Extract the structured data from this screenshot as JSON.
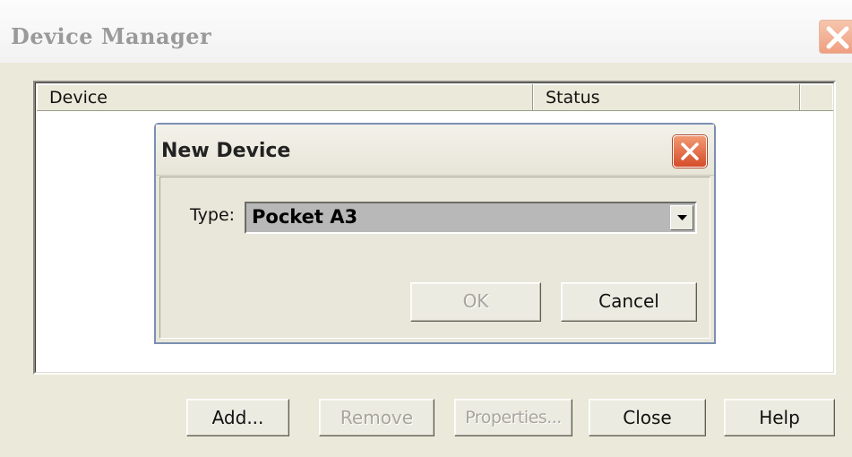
{
  "window": {
    "title": "Device Manager",
    "close_icon": "close-icon"
  },
  "device_list": {
    "columns": [
      "Device",
      "Status",
      ""
    ]
  },
  "buttons": {
    "add": "Add...",
    "remove": "Remove",
    "properties": "Properties...",
    "close": "Close",
    "help": "Help"
  },
  "dialog": {
    "title": "New Device",
    "type_label": "Type:",
    "type_value": "Pocket A3",
    "ok": "OK",
    "cancel": "Cancel"
  },
  "colors": {
    "window_bg": "#ebe9d9",
    "dialog_border": "#7c8fb2",
    "close_red": "#d64c2a"
  }
}
